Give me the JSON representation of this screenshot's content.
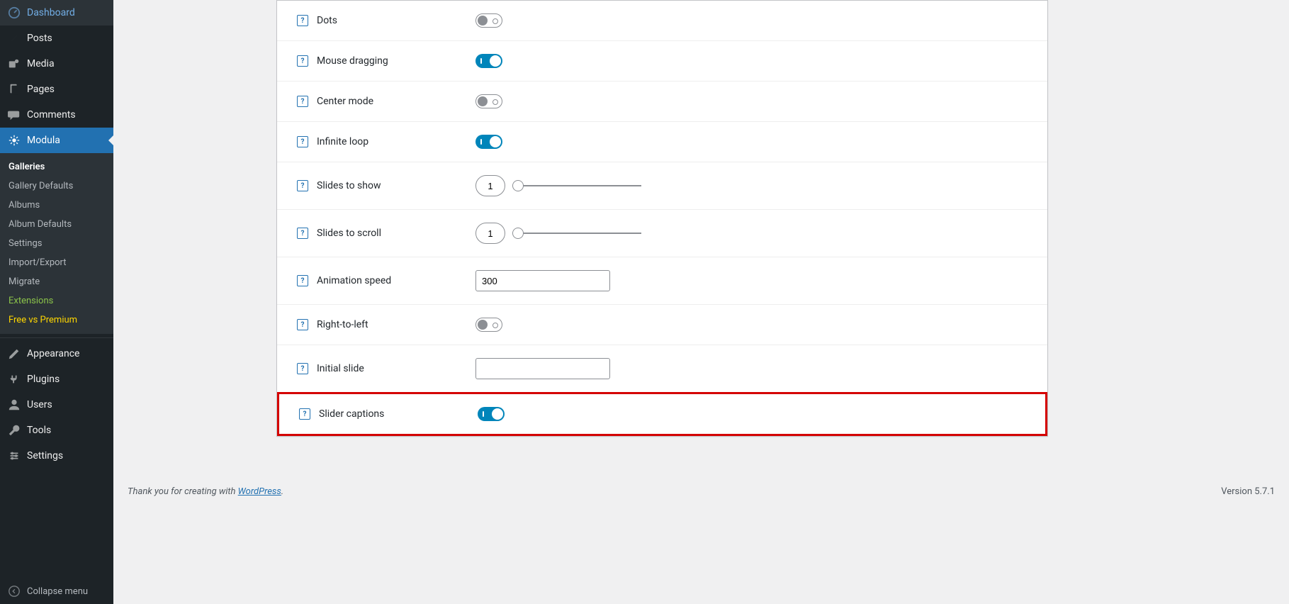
{
  "sidebar": {
    "dashboard": "Dashboard",
    "posts": "Posts",
    "media": "Media",
    "pages": "Pages",
    "comments": "Comments",
    "modula": "Modula",
    "submenu": {
      "galleries": "Galleries",
      "gallery_defaults": "Gallery Defaults",
      "albums": "Albums",
      "album_defaults": "Album Defaults",
      "settings": "Settings",
      "import_export": "Import/Export",
      "migrate": "Migrate",
      "extensions": "Extensions",
      "free_vs_premium": "Free vs Premium"
    },
    "appearance": "Appearance",
    "plugins": "Plugins",
    "users": "Users",
    "tools": "Tools",
    "settings_menu": "Settings",
    "collapse": "Collapse menu"
  },
  "settings": {
    "dots": {
      "label": "Dots",
      "on": false
    },
    "mouse_dragging": {
      "label": "Mouse dragging",
      "on": true
    },
    "center_mode": {
      "label": "Center mode",
      "on": false
    },
    "infinite_loop": {
      "label": "Infinite loop",
      "on": true
    },
    "slides_to_show": {
      "label": "Slides to show",
      "value": "1"
    },
    "slides_to_scroll": {
      "label": "Slides to scroll",
      "value": "1"
    },
    "animation_speed": {
      "label": "Animation speed",
      "value": "300"
    },
    "right_to_left": {
      "label": "Right-to-left",
      "on": false
    },
    "initial_slide": {
      "label": "Initial slide",
      "value": ""
    },
    "slider_captions": {
      "label": "Slider captions",
      "on": true
    }
  },
  "help_glyph": "?",
  "footer": {
    "thank": "Thank you for creating with ",
    "wp": "WordPress",
    "dot": ".",
    "version": "Version 5.7.1"
  }
}
